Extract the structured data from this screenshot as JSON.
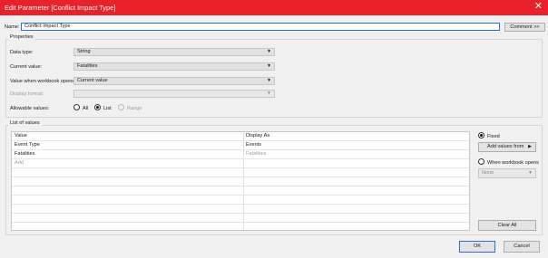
{
  "window": {
    "title": "Edit Parameter [Conflict Impact Type]",
    "close_glyph": "✕"
  },
  "name_row": {
    "label": "Name:",
    "value": "Conflict Impact Type",
    "comment_button": "Comment >>"
  },
  "properties": {
    "title": "Properties",
    "data_type": {
      "label": "Data type:",
      "value": "String"
    },
    "current_value": {
      "label": "Current value:",
      "value": "Fatalities"
    },
    "value_when_opens": {
      "label": "Value when workbook opens:",
      "value": "Current value"
    },
    "display_format": {
      "label": "Display format:",
      "value": ""
    },
    "allowable_values": {
      "label": "Allowable values:",
      "options": [
        {
          "label": "All",
          "selected": false,
          "enabled": true
        },
        {
          "label": "List",
          "selected": true,
          "enabled": true
        },
        {
          "label": "Range",
          "selected": false,
          "enabled": false
        }
      ]
    }
  },
  "list_of_values": {
    "title": "List of values",
    "columns": [
      "Value",
      "Display As"
    ],
    "rows": [
      {
        "value": "Event Type",
        "display": "Events",
        "placeholder": false
      },
      {
        "value": "Fatalities",
        "display": "Fatalities",
        "placeholder": true
      },
      {
        "value": "Add",
        "display": "",
        "placeholder": true
      }
    ]
  },
  "side_panel": {
    "fixed": {
      "label": "Fixed",
      "selected": true
    },
    "add_values_from": "Add values from",
    "when_workbook_opens": {
      "label": "When workbook opens",
      "selected": false
    },
    "source_value": "None",
    "clear_all": "Clear All"
  },
  "footer": {
    "ok": "OK",
    "cancel": "Cancel"
  },
  "icons": {
    "dropdown_arrow": "▼",
    "submenu_arrow": "▶"
  },
  "colors": {
    "titlebar": "#e8212a",
    "focus_border": "#2d6fc9"
  }
}
